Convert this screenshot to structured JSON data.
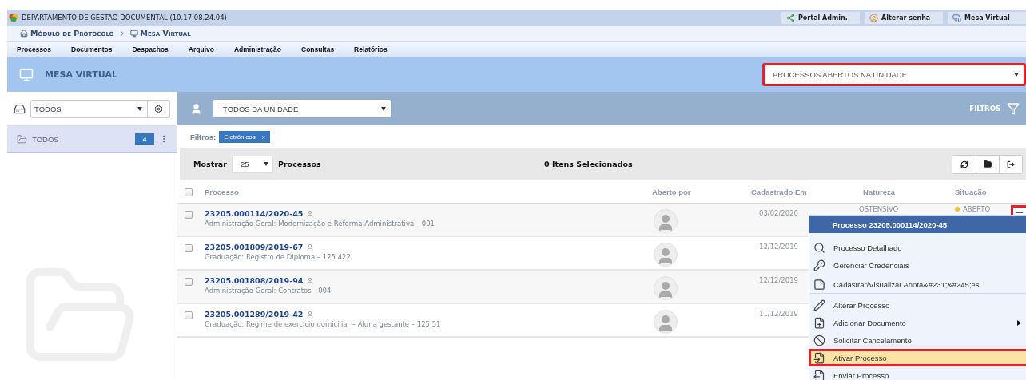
{
  "system_bar": {
    "title": "DEPARTAMENTO DE GESTÃO DOCUMENTAL (10.17.08.24.04)",
    "links": [
      {
        "label": "Portal Admin.",
        "kind": "portal"
      },
      {
        "label": "Alterar senha",
        "kind": "password"
      },
      {
        "label": "Mesa Virtual",
        "kind": "desk"
      }
    ]
  },
  "breadcrumb": [
    "Módulo de Protocolo",
    "Mesa Virtual"
  ],
  "menu": [
    "Processos",
    "Documentos",
    "Despachos",
    "Arquivo",
    "Administração",
    "Consultas",
    "Relatórios"
  ],
  "page_title": "MESA VIRTUAL",
  "view_select": {
    "value": "PROCESSOS ABERTOS NA UNIDADE",
    "highlighted": true
  },
  "sidebar": {
    "select": {
      "value": "TODOS"
    },
    "folders": [
      {
        "label": "TODOS",
        "count": "4",
        "selected": true
      }
    ]
  },
  "toolbar": {
    "user_select": {
      "value": "TODOS DA UNIDADE"
    },
    "filters_label": "FILTROS"
  },
  "active_filters": {
    "label": "Filtros:",
    "tags": [
      {
        "label": "Eletrônicos",
        "remove": "x"
      }
    ]
  },
  "list_bar": {
    "show_label": "Mostrar",
    "page_size": "25",
    "unit_label": "Processos",
    "selection": "0 Itens Selecionados"
  },
  "table": {
    "select_all": {
      "checked": false
    },
    "columns": [
      "Processo",
      "Aberto por",
      "Cadastrado Em",
      "Natureza",
      "Situação"
    ],
    "rows": [
      {
        "checked": false,
        "number": "23205.000114/2020-45",
        "subject": "Administração Geral: Modernização e Reforma Administrativa – 001",
        "date": "03/02/2020",
        "natureza": "OSTENSIVO",
        "situacao": {
          "label": "ABERTO",
          "color": "#f0c02f"
        }
      },
      {
        "checked": false,
        "number": "23205.001809/2019-67",
        "subject": "Graduação: Registro de Diploma – 125.422",
        "date": "12/12/2019"
      },
      {
        "checked": false,
        "number": "23205.001808/2019-94",
        "subject": "Administração Geral: Contratos - 004",
        "date": "12/12/2019"
      },
      {
        "checked": false,
        "number": "23205.001289/2019-42",
        "subject": "Graduação: Regime de exercício domiciliar – Aluna gestante – 125.51",
        "date": "11/12/2019"
      }
    ]
  },
  "context_menu": {
    "title": "Processo 23205.000114/2020-45",
    "items": [
      {
        "label": "Processo Detalhado",
        "kind": "search",
        "selected": false,
        "submenu": false,
        "divider_after": false
      },
      {
        "label": "Gerenciar Credenciais",
        "kind": "credentials",
        "selected": false,
        "submenu": false,
        "divider_after": false
      },
      {
        "label": "Cadastrar/Visualizar Anota&#231;&#245;es",
        "kind": "note",
        "selected": false,
        "submenu": false,
        "divider_after": true
      },
      {
        "label": "Alterar Processo",
        "kind": "edit",
        "selected": false,
        "submenu": false,
        "divider_after": false
      },
      {
        "label": "Adicionar Documento",
        "kind": "add-doc",
        "selected": false,
        "submenu": true,
        "divider_after": false
      },
      {
        "label": "Solicitar Cancelamento",
        "kind": "cancel",
        "selected": false,
        "submenu": false,
        "divider_after": false
      },
      {
        "label": "Ativar Processo",
        "kind": "activate",
        "selected": true,
        "submenu": false,
        "divider_after": false
      },
      {
        "label": "Enviar Processo",
        "kind": "send",
        "selected": false,
        "submenu": false,
        "divider_after": false
      }
    ]
  }
}
